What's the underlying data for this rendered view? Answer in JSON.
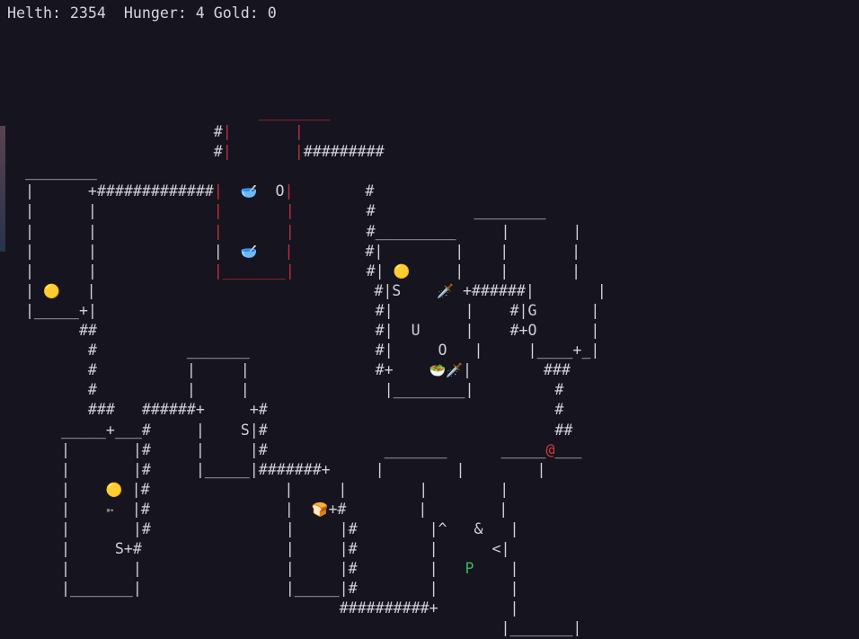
{
  "status": {
    "text": "Helth: 2354  Hunger: 4 Gold: 0"
  },
  "map": {
    "rows": [
      [
        {
          "t": "                          ________",
          "c": "red"
        }
      ],
      [
        {
          "t": "                     #"
        },
        {
          "t": "|       |",
          "c": "red"
        }
      ],
      [
        {
          "t": "                     #"
        },
        {
          "t": "|       |",
          "c": "red"
        },
        {
          "t": "#########"
        }
      ],
      [
        {
          "t": "________"
        }
      ],
      [
        {
          "t": "|      +#############"
        },
        {
          "t": "|",
          "c": "red"
        },
        {
          "t": "  "
        },
        {
          "t": "🥣",
          "e": "bowl"
        },
        {
          "t": "  O"
        },
        {
          "t": "|",
          "c": "red"
        },
        {
          "t": "        #"
        }
      ],
      [
        {
          "t": "|      |             "
        },
        {
          "t": "|       |",
          "c": "red"
        },
        {
          "t": "        #           ________"
        }
      ],
      [
        {
          "t": "|      |             "
        },
        {
          "t": "|       |",
          "c": "red"
        },
        {
          "t": "        #_________     |       |"
        }
      ],
      [
        {
          "t": "|      |             "
        },
        {
          "t": "|  "
        },
        {
          "t": "🥣",
          "e": "bowl"
        },
        {
          "t": "   |",
          "c": "red"
        },
        {
          "t": "        #|        |    |       |"
        }
      ],
      [
        {
          "t": "|      |             "
        },
        {
          "t": "|_______|",
          "c": "red"
        },
        {
          "t": "        #| "
        },
        {
          "t": "🟡",
          "e": "coin"
        },
        {
          "t": "     |    |       |"
        }
      ],
      [
        {
          "t": "| "
        },
        {
          "t": "🟡",
          "e": "coin"
        },
        {
          "t": "   |                               #|S    "
        },
        {
          "t": "🗡️",
          "e": "dagger"
        },
        {
          "t": " +######|       |"
        }
      ],
      [
        {
          "t": "|_____+|                               #|        |    #|G      |"
        }
      ],
      [
        {
          "t": "      ##                               #|  U     |    #+O      |"
        }
      ],
      [
        {
          "t": "       #          _______              #|     O   |     |____+_|"
        }
      ],
      [
        {
          "t": "       #          |     |              #+    "
        },
        {
          "t": "🥗🗡️",
          "e": "salad-dagger"
        },
        {
          "t": "|        ###"
        }
      ],
      [
        {
          "t": "       #          |     |               |________|         #"
        }
      ],
      [
        {
          "t": "       ###   ######+     +#                                #"
        }
      ],
      [
        {
          "t": "    _____+___#     |    S|#                                ##"
        }
      ],
      [
        {
          "t": "    |       |#     |     |#             _______      _____"
        },
        {
          "t": "@",
          "c": "player"
        },
        {
          "t": "___"
        }
      ],
      [
        {
          "t": "    |       |#     |_____|#######+     |        |        |"
        }
      ],
      [
        {
          "t": "    |    "
        },
        {
          "t": "🟡",
          "e": "coin"
        },
        {
          "t": " |#               |     |        |        |"
        }
      ],
      [
        {
          "t": "    |    "
        },
        {
          "t": "➳",
          "e": "arrow"
        },
        {
          "t": "  |#               |  "
        },
        {
          "t": "🍞",
          "e": "bread"
        },
        {
          "t": "+#        |        |"
        }
      ],
      [
        {
          "t": "    |       |#               |     |#        |^   &   |"
        }
      ],
      [
        {
          "t": "    |     S+#                |     |#        |      <|"
        }
      ],
      [
        {
          "t": "    |       |                |     |#        |   "
        },
        {
          "t": "P",
          "c": "green"
        },
        {
          "t": "    |"
        }
      ],
      [
        {
          "t": "    |_______|                |_____|#        |        |"
        }
      ],
      [
        {
          "t": "                                   ##########+        |"
        }
      ],
      [
        {
          "t": "                                                     |_______|"
        }
      ]
    ]
  }
}
